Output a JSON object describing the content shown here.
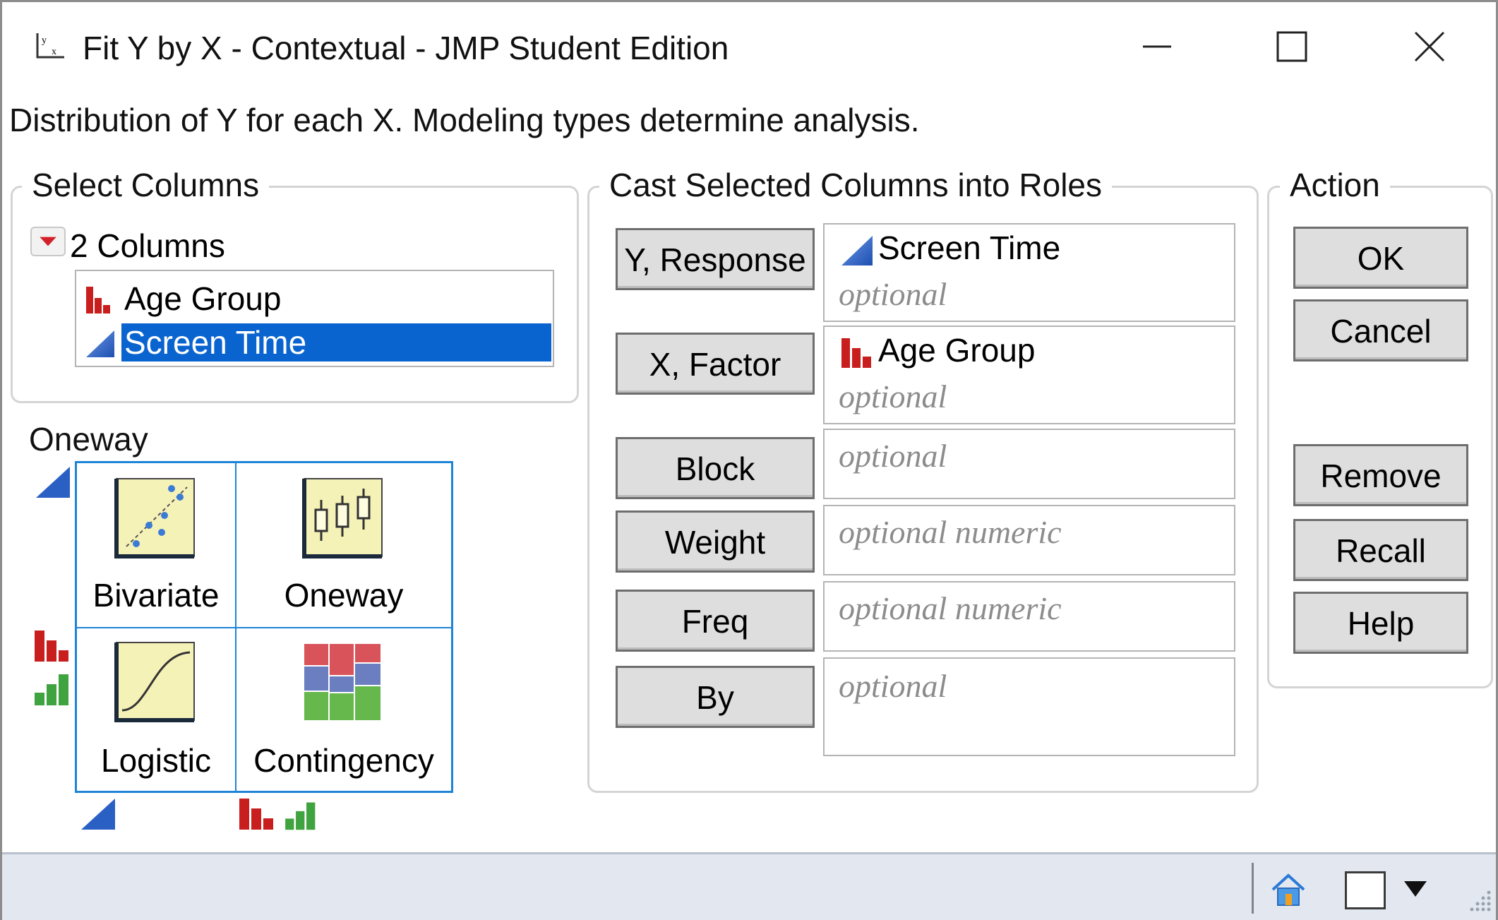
{
  "window": {
    "title": "Fit Y by X - Contextual - JMP Student Edition",
    "app_icon": "fit-y-by-x-icon",
    "controls": [
      "minimize-icon",
      "maximize-icon",
      "close-icon"
    ]
  },
  "description": "Distribution of Y for each X. Modeling types determine analysis.",
  "select_columns": {
    "label": "Select Columns",
    "count_label": "2 Columns",
    "columns": [
      {
        "name": "Age Group",
        "icon": "nominal-bar-icon",
        "selected": false
      },
      {
        "name": "Screen Time",
        "icon": "continuous-triangle-icon",
        "selected": true
      }
    ]
  },
  "analysis": {
    "current": "Oneway",
    "grid": [
      {
        "label": "Bivariate",
        "icon": "bivariate-scatter-icon"
      },
      {
        "label": "Oneway",
        "icon": "oneway-boxplot-icon"
      },
      {
        "label": "Logistic",
        "icon": "logistic-curve-icon"
      },
      {
        "label": "Contingency",
        "icon": "contingency-mosaic-icon"
      }
    ]
  },
  "roles": {
    "label": "Cast Selected Columns into Roles",
    "items": [
      {
        "button": "Y, Response",
        "value": "Screen Time",
        "value_icon": "continuous-triangle-icon",
        "placeholder": "optional"
      },
      {
        "button": "X, Factor",
        "value": "Age Group",
        "value_icon": "nominal-bar-icon",
        "placeholder": "optional"
      },
      {
        "button": "Block",
        "value": "",
        "placeholder": "optional"
      },
      {
        "button": "Weight",
        "value": "",
        "placeholder": "optional numeric"
      },
      {
        "button": "Freq",
        "value": "",
        "placeholder": "optional numeric"
      },
      {
        "button": "By",
        "value": "",
        "placeholder": "optional"
      }
    ]
  },
  "action": {
    "label": "Action",
    "buttons": [
      "OK",
      "Cancel",
      "Remove",
      "Recall",
      "Help"
    ]
  },
  "statusbar": {
    "icons": [
      "home-icon",
      "window-square-icon",
      "dropdown-arrow-icon",
      "resize-grip-icon"
    ]
  },
  "colors": {
    "selection": "#0a64d0",
    "grid_border": "#1e84d8",
    "nominal_red": "#c81e1e",
    "ordinal_green": "#3fa33f",
    "continuous_blue": "#2a5fc4"
  }
}
